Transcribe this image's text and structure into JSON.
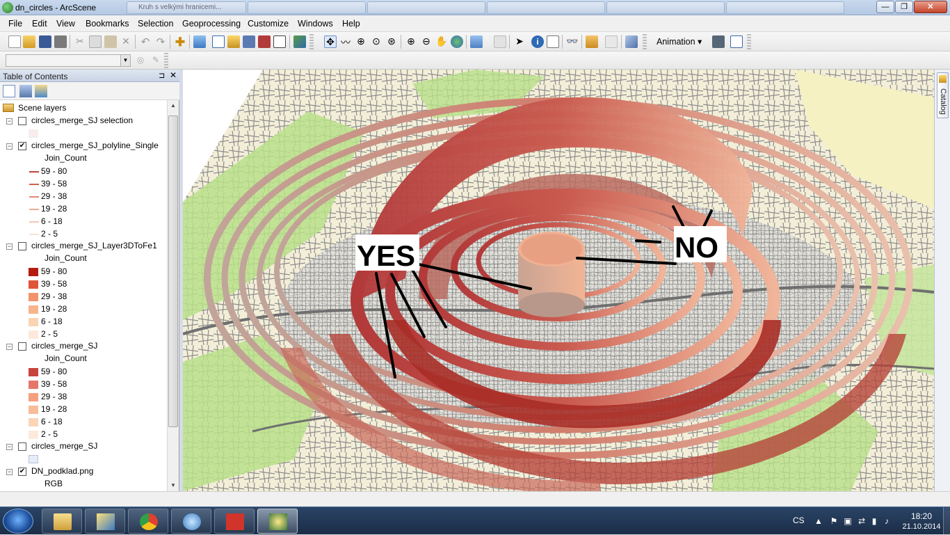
{
  "window": {
    "title": "dn_circles - ArcScene",
    "background_tabs": [
      "Kruh s velkými hranicemi...",
      "",
      "",
      "",
      ""
    ],
    "controls": {
      "minimize": "—",
      "maximize": "❐",
      "close": "✕"
    }
  },
  "menu": [
    "File",
    "Edit",
    "View",
    "Bookmarks",
    "Selection",
    "Geoprocessing",
    "Customize",
    "Windows",
    "Help"
  ],
  "toolbar": {
    "animation_label": "Animation ▾",
    "layer_dropdown_value": ""
  },
  "toc": {
    "title": "Table of Contents",
    "pin": "⊐",
    "close": "✕",
    "root_label": "Scene layers",
    "layers": [
      {
        "name": "circles_merge_SJ selection",
        "checked": false,
        "expanded": true,
        "field": "",
        "legend": []
      },
      {
        "name": "circles_merge_SJ_polyline_Single",
        "checked": true,
        "expanded": true,
        "field": "Join_Count",
        "legend": [
          {
            "label": "59 - 80",
            "color": "#c0443a",
            "kind": "line"
          },
          {
            "label": "39 - 58",
            "color": "#d0604e",
            "kind": "line"
          },
          {
            "label": "29 - 38",
            "color": "#df8a72",
            "kind": "line"
          },
          {
            "label": "19 - 28",
            "color": "#ebab94",
            "kind": "line"
          },
          {
            "label": "6 - 18",
            "color": "#f2c7b3",
            "kind": "line"
          },
          {
            "label": "2 - 5",
            "color": "#f8e2d7",
            "kind": "line"
          }
        ]
      },
      {
        "name": "circles_merge_SJ_Layer3DToFe1",
        "checked": false,
        "expanded": true,
        "field": "Join_Count",
        "legend": [
          {
            "label": "59 - 80",
            "color": "#b51c0f",
            "kind": "fill"
          },
          {
            "label": "39 - 58",
            "color": "#e0553a",
            "kind": "fill"
          },
          {
            "label": "29 - 38",
            "color": "#f3936b",
            "kind": "fill"
          },
          {
            "label": "19 - 28",
            "color": "#f8b58d",
            "kind": "fill"
          },
          {
            "label": "6 - 18",
            "color": "#fbd4b4",
            "kind": "fill"
          },
          {
            "label": "2 - 5",
            "color": "#fde9dc",
            "kind": "fill"
          }
        ]
      },
      {
        "name": "circles_merge_SJ",
        "checked": false,
        "expanded": true,
        "field": "Join_Count",
        "legend": [
          {
            "label": "59 - 80",
            "color": "#c9443f",
            "kind": "fill"
          },
          {
            "label": "39 - 58",
            "color": "#e5766a",
            "kind": "fill"
          },
          {
            "label": "29 - 38",
            "color": "#f4a07e",
            "kind": "fill"
          },
          {
            "label": "19 - 28",
            "color": "#f8bc98",
            "kind": "fill"
          },
          {
            "label": "6 - 18",
            "color": "#fbd5b8",
            "kind": "fill"
          },
          {
            "label": "2 - 5",
            "color": "#fdeadd",
            "kind": "fill"
          }
        ]
      },
      {
        "name": "circles_merge_SJ",
        "checked": false,
        "expanded": true,
        "field": "",
        "legend": []
      },
      {
        "name": "DN_podklad.png",
        "checked": true,
        "expanded": true,
        "field": "RGB",
        "legend": []
      }
    ]
  },
  "scene": {
    "label_yes": "YES",
    "label_no": "NO"
  },
  "catalog": {
    "label": "Catalog"
  },
  "taskbar": {
    "language": "CS",
    "time": "18:20",
    "date": "21.10.2014"
  }
}
